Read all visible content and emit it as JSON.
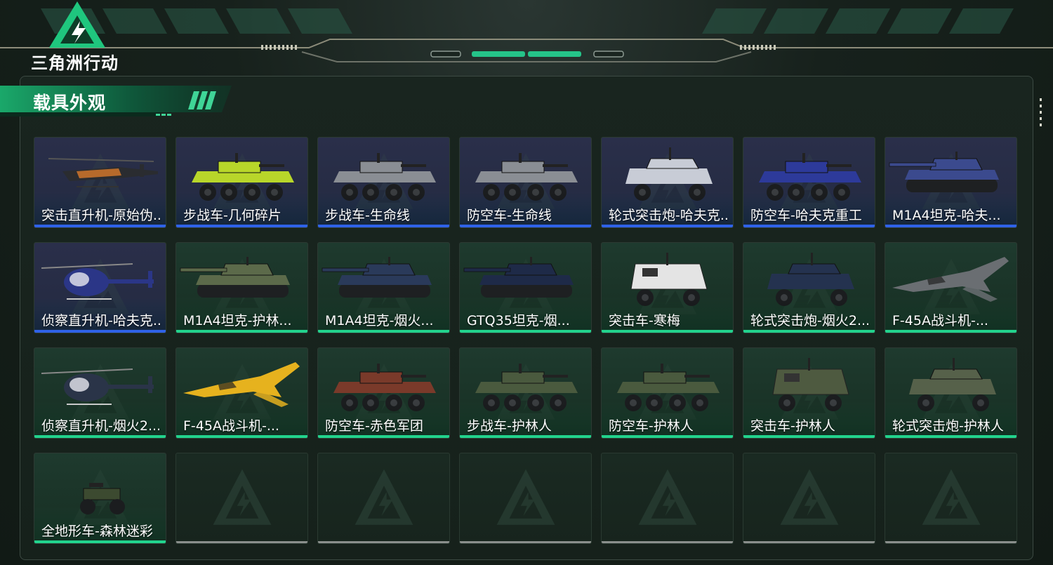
{
  "game_title": "三角洲行动",
  "section_title": "载具外观",
  "colors": {
    "accent_green": "#22d38d",
    "rarity_blue": "#2f62e8",
    "empty_gray": "#8a8f8c"
  },
  "cards": [
    {
      "name": "突击直升机-原始伪...",
      "rarity": "blue",
      "kind": "heli-attack",
      "tint": "#d97a2a"
    },
    {
      "name": "步战车-几何碎片",
      "rarity": "blue",
      "kind": "apc",
      "tint": "#b8d62a"
    },
    {
      "name": "步战车-生命线",
      "rarity": "blue",
      "kind": "apc",
      "tint": "#8a8e94"
    },
    {
      "name": "防空车-生命线",
      "rarity": "blue",
      "kind": "apc",
      "tint": "#8a8e94"
    },
    {
      "name": "轮式突击炮-哈夫克...",
      "rarity": "blue",
      "kind": "jeep",
      "tint": "#c8ccd6"
    },
    {
      "name": "防空车-哈夫克重工",
      "rarity": "blue",
      "kind": "apc",
      "tint": "#2d3a9a"
    },
    {
      "name": "M1A4坦克-哈夫...",
      "rarity": "blue",
      "kind": "tank",
      "tint": "#3b4a8e"
    },
    {
      "name": "侦察直升机-哈夫克...",
      "rarity": "blue",
      "kind": "heli-scout",
      "tint": "#2b3687"
    },
    {
      "name": "M1A4坦克-护林...",
      "rarity": "green",
      "kind": "tank",
      "tint": "#5c6a4a"
    },
    {
      "name": "M1A4坦克-烟火...",
      "rarity": "green",
      "kind": "tank",
      "tint": "#2a3a5a"
    },
    {
      "name": "GTQ35坦克-烟...",
      "rarity": "green",
      "kind": "tank",
      "tint": "#1e2a48"
    },
    {
      "name": "突击车-寒梅",
      "rarity": "green",
      "kind": "mrap",
      "tint": "#e4e4e4"
    },
    {
      "name": "轮式突击炮-烟火2...",
      "rarity": "green",
      "kind": "jeep",
      "tint": "#24324f"
    },
    {
      "name": "F-45A战斗机-...",
      "rarity": "green",
      "kind": "jet",
      "tint": "#6a6e72"
    },
    {
      "name": "侦察直升机-烟火2...",
      "rarity": "green",
      "kind": "heli-scout",
      "tint": "#2a3448"
    },
    {
      "name": "F-45A战斗机-...",
      "rarity": "green",
      "kind": "jet",
      "tint": "#e6b21e"
    },
    {
      "name": "防空车-赤色军团",
      "rarity": "green",
      "kind": "apc",
      "tint": "#7a3a2a"
    },
    {
      "name": "步战车-护林人",
      "rarity": "green",
      "kind": "apc",
      "tint": "#4a5a3e"
    },
    {
      "name": "防空车-护林人",
      "rarity": "green",
      "kind": "apc",
      "tint": "#4a5a3e"
    },
    {
      "name": "突击车-护林人",
      "rarity": "green",
      "kind": "mrap",
      "tint": "#4e5a40"
    },
    {
      "name": "轮式突击炮-护林人",
      "rarity": "green",
      "kind": "jeep",
      "tint": "#56614a"
    },
    {
      "name": "全地形车-森林迷彩",
      "rarity": "green",
      "kind": "atv",
      "tint": "#3c4a30"
    },
    {
      "name": "",
      "rarity": "empty",
      "kind": "",
      "tint": ""
    },
    {
      "name": "",
      "rarity": "empty",
      "kind": "",
      "tint": ""
    },
    {
      "name": "",
      "rarity": "empty",
      "kind": "",
      "tint": ""
    },
    {
      "name": "",
      "rarity": "empty",
      "kind": "",
      "tint": ""
    },
    {
      "name": "",
      "rarity": "empty",
      "kind": "",
      "tint": ""
    },
    {
      "name": "",
      "rarity": "empty",
      "kind": "",
      "tint": ""
    }
  ]
}
